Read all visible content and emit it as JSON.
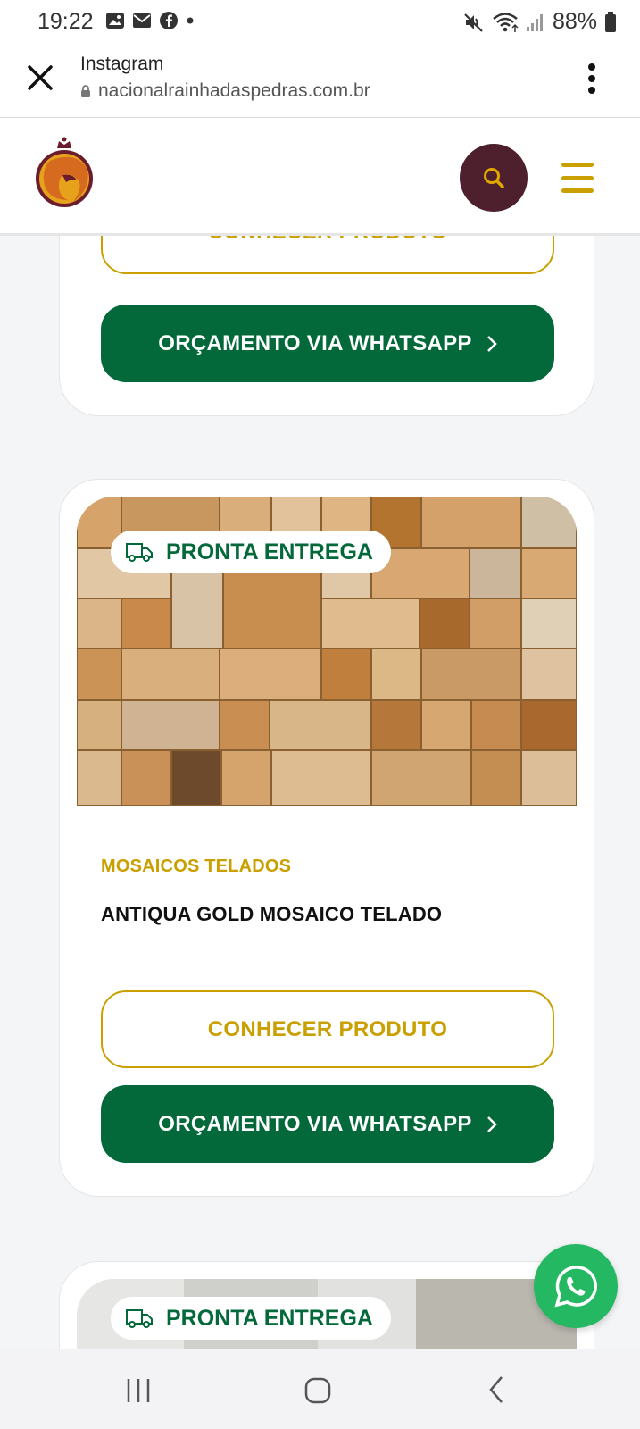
{
  "status_bar": {
    "time": "19:22",
    "battery": "88%",
    "left_icons": [
      "image-icon",
      "mail-icon",
      "facebook-icon",
      "dot-icon"
    ],
    "right_icons": [
      "mute-icon",
      "wifi-icon",
      "signal-icon",
      "battery-icon"
    ]
  },
  "browser": {
    "title": "Instagram",
    "url": "nacionalrainhadaspedras.com.br"
  },
  "header": {
    "logo": "logo-icon",
    "search": "search-icon",
    "menu": "menu-icon"
  },
  "cards": [
    {
      "know_label": "CONHECER PRODUTO",
      "whatsapp_label": "ORÇAMENTO VIA WHATSAPP"
    },
    {
      "badge": "PRONTA ENTREGA",
      "category": "MOSAICOS TELADOS",
      "name": "ANTIQUA GOLD MOSAICO TELADO",
      "know_label": "CONHECER PRODUTO",
      "whatsapp_label": "ORÇAMENTO VIA WHATSAPP"
    },
    {
      "badge": "PRONTA ENTREGA"
    }
  ],
  "colors": {
    "gold": "#c9a000",
    "green": "#03693a",
    "maroon": "#4e1f2c",
    "whatsapp": "#25b863"
  }
}
